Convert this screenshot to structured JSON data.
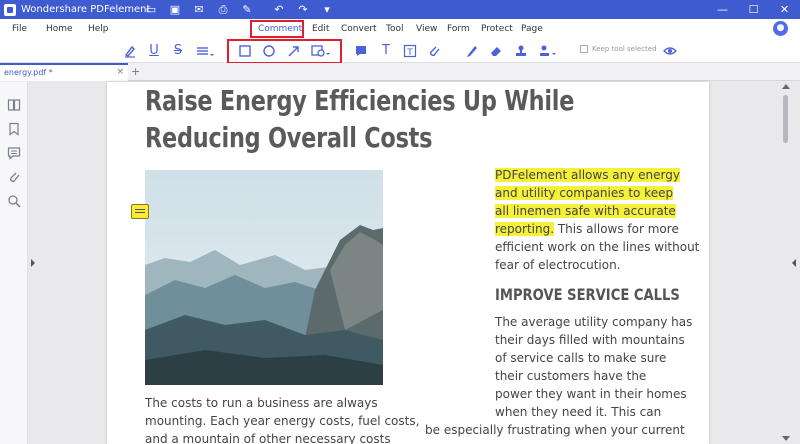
{
  "app": {
    "title": "Wondershare PDFelement",
    "quick_access": [
      "folder-icon",
      "save-icon",
      "email-icon",
      "print-icon",
      "edit-icon",
      "undo-icon",
      "redo-icon",
      "dropdown-icon"
    ]
  },
  "menu": {
    "items": [
      "File",
      "Home",
      "Help",
      "Comment",
      "Edit",
      "Convert",
      "Tool",
      "View",
      "Form",
      "Protect",
      "Page"
    ],
    "active": "Comment"
  },
  "toolbar": {
    "keep_tool_label": "Keep tool selected"
  },
  "tab": {
    "label": "energy.pdf *"
  },
  "document": {
    "title_line1": "Raise Energy Efficiencies Up While",
    "title_line2": "Reducing Overall Costs",
    "right_col_lines": [
      "PDFelement allows any energy",
      "and utility companies to keep",
      "all linemen safe with accurate",
      "reporting.",
      " This allows for more",
      "efficient work on the lines without",
      "fear of electrocution."
    ],
    "section_heading": "IMPROVE SERVICE CALLS",
    "service_lines": [
      "The average utility company has",
      "their days filled with mountains",
      "of service calls to make sure",
      "their customers have the",
      "power they want in their homes",
      "when they need it. This can",
      "be especially frustrating when your current"
    ],
    "left_col_lines": [
      "The costs to run a business are always",
      "mounting. Each year energy costs, fuel costs,",
      "and a mountain of other necessary costs"
    ]
  },
  "colors": {
    "brand": "#3f5bd0",
    "highlight": "#f5f03a",
    "annotation_box": "#e01e2d"
  }
}
